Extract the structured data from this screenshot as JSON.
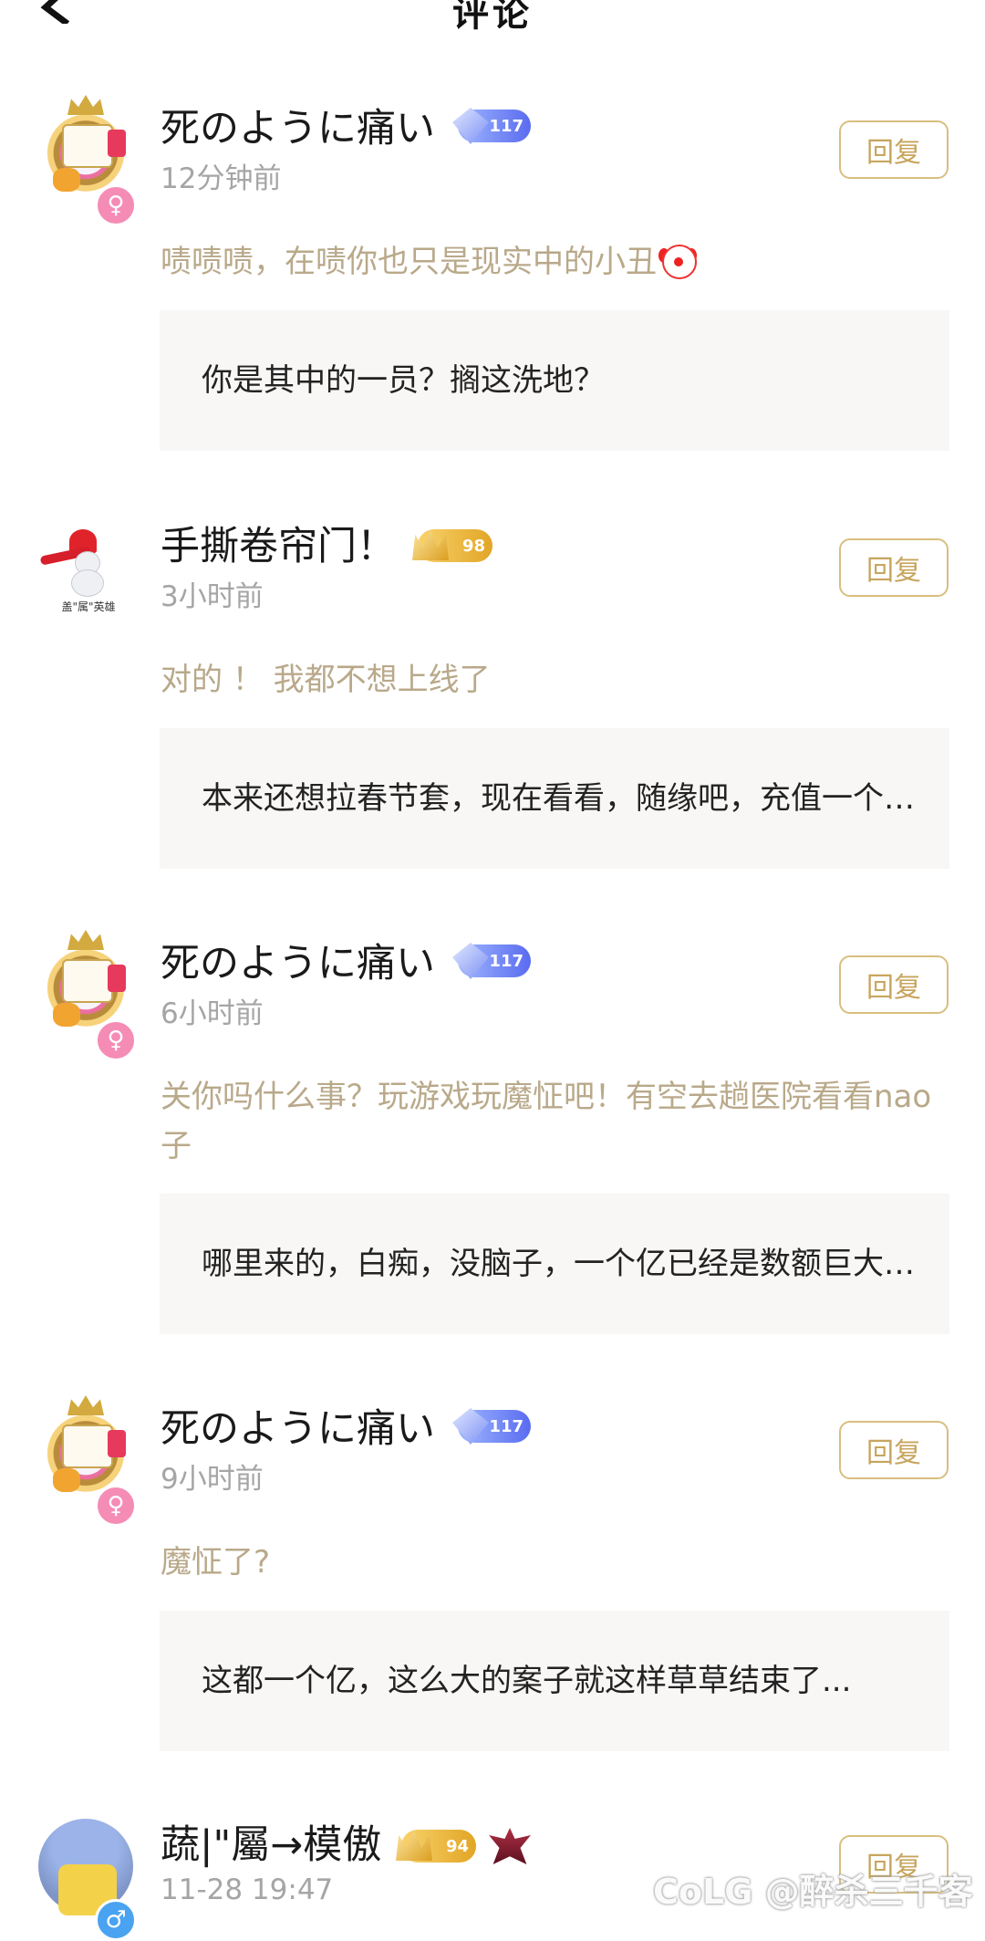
{
  "header": {
    "title": "评论"
  },
  "comments": [
    {
      "username": "死のように痛い",
      "level": "117",
      "time": "12分钟前",
      "reply_label": "回复",
      "text": "啧啧啧，在啧你也只是现实中的小丑",
      "emoji": "clown-face",
      "quote": "你是其中的一员？搁这洗地？",
      "gender": "♀"
    },
    {
      "username": "手撕卷帘门！",
      "level": "98",
      "time": "3小时前",
      "reply_label": "回复",
      "text": "对的 ！ 我都不想上线了",
      "quote": "本来还想拉春节套，现在看看，随缘吧，充值一个亿，这个案子没了下文...",
      "avatar_caption": "盖\"属\"英雄"
    },
    {
      "username": "死のように痛い",
      "level": "117",
      "time": "6小时前",
      "reply_label": "回复",
      "text": "关你吗什么事？玩游戏玩魔怔吧！有空去趟医院看看nao子",
      "quote": "哪里来的，白痴，没脑子，一个亿已经是数额巨大了...",
      "gender": "♀"
    },
    {
      "username": "死のように痛い",
      "level": "117",
      "time": "9小时前",
      "reply_label": "回复",
      "text": "魔怔了?",
      "quote": "这都一个亿，这么大的案子就这样草草结束了...",
      "gender": "♀"
    },
    {
      "username": "蔬|\"屬→模傲",
      "level": "94",
      "time": "11-28 19:47",
      "reply_label": "回复",
      "gender": "♂"
    }
  ],
  "watermark": "CoLG @醉杀三千客"
}
